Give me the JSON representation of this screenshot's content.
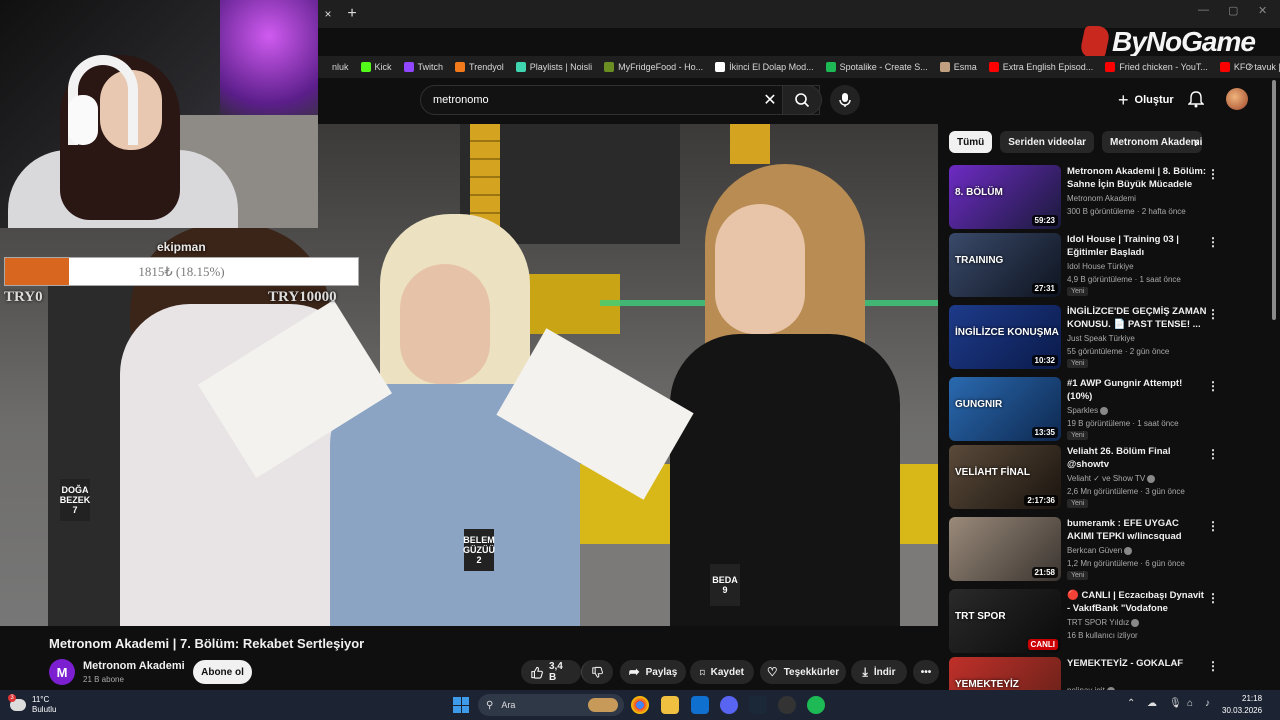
{
  "browser": {
    "tab_close": "×",
    "new_tab": "+",
    "watermark": "ByNoGame",
    "bookmarks": [
      {
        "label": "nluk",
        "color": "#1f1f1f"
      },
      {
        "label": "Kick",
        "color": "#53fc18"
      },
      {
        "label": "Twitch",
        "color": "#9146ff"
      },
      {
        "label": "Trendyol",
        "color": "#f27a1a"
      },
      {
        "label": "Playlists | Noisli",
        "color": "#3ed5b0"
      },
      {
        "label": "MyFridgeFood - Ho...",
        "color": "#6b8e23"
      },
      {
        "label": "İkinci El Dolap Mod...",
        "color": "#ffffff"
      },
      {
        "label": "Spotalike - Create S...",
        "color": "#1db954"
      },
      {
        "label": "Esma",
        "color": "#c0a080"
      },
      {
        "label": "Extra English Episod...",
        "color": "#ff0000"
      },
      {
        "label": "Fried chicken - YouT...",
        "color": "#ff0000"
      },
      {
        "label": "KFC tavuk | çıtır kıza...",
        "color": "#ff0000"
      }
    ],
    "bookmarks_more": "»"
  },
  "youtube": {
    "search_value": "metronomo",
    "create_label": "Oluştur",
    "video_title": "Metronom Akademi | 7. Bölüm: Rekabet Sertleşiyor",
    "channel_name": "Metronom Akademi",
    "channel_initial": "M",
    "subscribers": "21 B abone",
    "subscribe_label": "Abone ol",
    "likes": "3,4 B",
    "share_label": "Paylaş",
    "save_label": "Kaydet",
    "thanks_label": "Teşekkürler",
    "download_label": "İndir",
    "more_label": "•••",
    "chips": [
      "Tümü",
      "Seriden videolar",
      "Metronom Akademi a"
    ],
    "chip_next": "›",
    "recommendations": [
      {
        "title": "Metronom Akademi | 8. Bölüm: Sahne İçin Büyük Mücadele",
        "channel": "Metronom Akademi",
        "verified": false,
        "meta": "300 B görüntüleme · 2 hafta önce",
        "duration": "59:23",
        "new": "",
        "thumb_colors": [
          "#6d2bc4",
          "#1a1a3a"
        ],
        "thumb_text": "8. BÖLÜM"
      },
      {
        "title": "Idol House | Training 03 | Eğitimler Başladı",
        "channel": "Idol House Türkiye",
        "verified": false,
        "meta": "4,9 B görüntüleme · 1 saat önce",
        "duration": "27:31",
        "new": "Yeni",
        "thumb_colors": [
          "#3a4a6a",
          "#0e1420"
        ],
        "thumb_text": "TRAINING"
      },
      {
        "title": "İNGİLİZCE'DE GEÇMİŞ ZAMAN KONUSU. 📄 PAST TENSE! ...",
        "channel": "Just Speak Türkiye",
        "verified": false,
        "meta": "55 görüntüleme · 2 gün önce",
        "duration": "10:32",
        "new": "Yeni",
        "thumb_colors": [
          "#1e3b8a",
          "#0a1a4a"
        ],
        "thumb_text": "İNGİLİZCE KONUŞMA"
      },
      {
        "title": "#1 AWP Gungnir Attempt! (10%)",
        "channel": "Sparkles",
        "verified": true,
        "meta": "19 B görüntüleme · 1 saat önce",
        "duration": "13:35",
        "new": "Yeni",
        "thumb_colors": [
          "#2a6ab0",
          "#0e2850"
        ],
        "thumb_text": "GUNGNIR"
      },
      {
        "title": "Veliaht 26. Bölüm Final @showtv",
        "channel": "Veliaht ✓ ve Show TV",
        "verified": true,
        "meta": "2,6 Mn görüntüleme · 3 gün önce",
        "duration": "2:17:36",
        "new": "Yeni",
        "thumb_colors": [
          "#5a4a3a",
          "#1a140e"
        ],
        "thumb_text": "VELİAHT FİNAL"
      },
      {
        "title": "bumeramk : EFE UYGAC AKIMI TEPKI w/lincsquad",
        "channel": "Berkcan Güven",
        "verified": true,
        "meta": "1,2 Mn görüntüleme · 6 gün önce",
        "duration": "21:58",
        "new": "Yeni",
        "thumb_colors": [
          "#9a8a7a",
          "#3a3430"
        ],
        "thumb_text": ""
      },
      {
        "title": "🔴 CANLI | Eczacıbaşı Dynavit - VakıfBank \"Vodafone Sultanlar...",
        "channel": "TRT SPOR Yıldız",
        "verified": true,
        "meta": "16 B kullanıcı izliyor",
        "duration": "CANLI",
        "new": "",
        "thumb_colors": [
          "#2a2a2a",
          "#0a0a0a"
        ],
        "thumb_text": "TRT SPOR"
      },
      {
        "title": "YEMEKTEYİZ - GOKALAF",
        "channel": "pelinay igit",
        "verified": true,
        "meta": "",
        "duration": "",
        "new": "",
        "thumb_colors": [
          "#c0302a",
          "#602018"
        ],
        "thumb_text": "YEMEKTEYİZ"
      }
    ]
  },
  "overlay": {
    "donor_name": "ekipman",
    "progress_text": "1815₺ (18.15%)",
    "progress": 0.1815,
    "min_label": "TRY0",
    "max_label": "TRY10000",
    "fill_color": "#d9661f"
  },
  "video_badges": [
    "DOĞA BEZEK 7",
    "BELEM GÜZÜÜ 2",
    "BEDA 9"
  ],
  "taskbar": {
    "weather_temp": "11°C",
    "weather_desc": "Bulutlu",
    "weather_badge": "3",
    "search_label": "Ara",
    "time": "21:18",
    "date": "30.03.2026"
  }
}
